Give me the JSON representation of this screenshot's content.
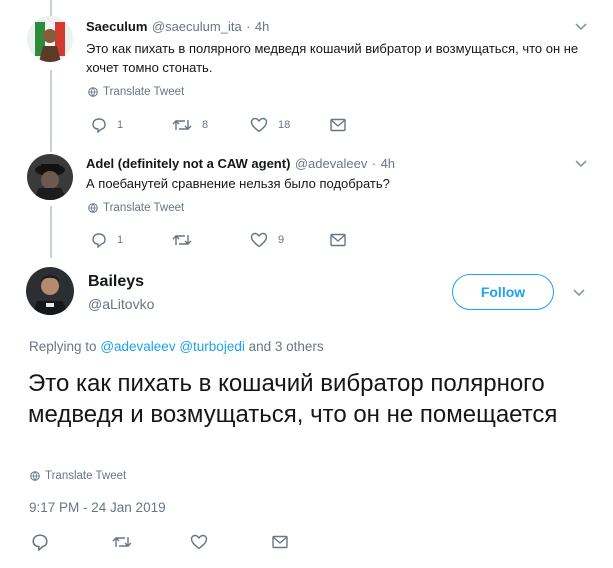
{
  "tweet1": {
    "name": "Saeculum",
    "handle": "@saeculum_ita",
    "dot": "·",
    "time": "4h",
    "text": "Это как пихать в полярного медведя кошачий вибратор и возмущаться, что он не хочет томно стонать.",
    "translate": "Translate Tweet",
    "replies": "1",
    "retweets": "8",
    "likes": "18"
  },
  "tweet2": {
    "name": "Adel (definitely not a CAW agent)",
    "handle": "@adevaleev",
    "dot": "·",
    "time": "4h",
    "text": "А поебанутей сравнение нельзя было подобрать?",
    "translate": "Translate Tweet",
    "replies": "1",
    "retweets": "",
    "likes": "9"
  },
  "main": {
    "name": "Baileys",
    "handle": "@aLitovko",
    "follow_label": "Follow",
    "replying_prefix": "Replying to",
    "replying_user1": "@adevaleev",
    "replying_user2": "@turbojedi",
    "replying_suffix": "and 3 others",
    "text": "Это как пихать в кошачий вибратор полярного медведя и возмущаться, что он не помещается",
    "translate": "Translate Tweet",
    "timestamp": "9:17 PM - 24 Jan 2019"
  },
  "colors": {
    "accent": "#1da1f2",
    "muted": "#657786",
    "thread_line": "#c8d2dc"
  }
}
